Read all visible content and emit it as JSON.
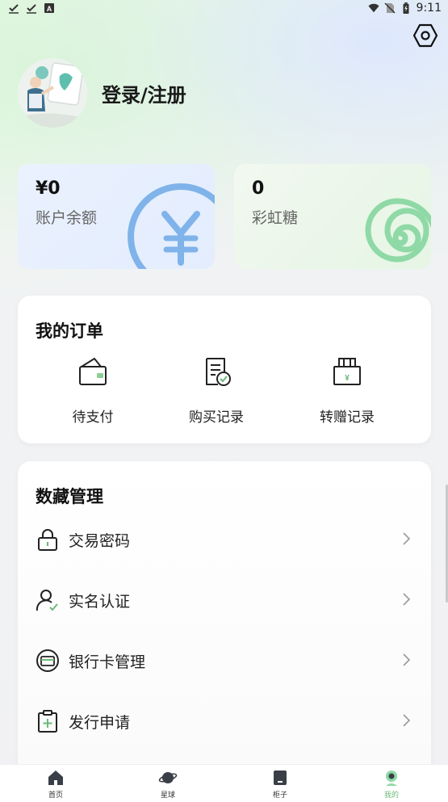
{
  "status_bar": {
    "time": "9:11",
    "left_icons": [
      "check-icon",
      "check-icon",
      "app-a-icon"
    ],
    "right_icons": [
      "wifi-icon",
      "no-sim-icon",
      "battery-icon"
    ]
  },
  "header": {
    "login_label": "登录/注册",
    "settings_icon": "hexagon-settings-icon"
  },
  "cards": {
    "balance": {
      "value": "¥0",
      "label": "账户余额",
      "accent": "#7fb3ea"
    },
    "candy": {
      "value": "0",
      "label": "彩虹糖",
      "accent": "#8fd9a6"
    }
  },
  "orders": {
    "title": "我的订单",
    "items": [
      {
        "label": "待支付",
        "icon": "wallet-icon"
      },
      {
        "label": "购买记录",
        "icon": "receipt-check-icon"
      },
      {
        "label": "转赠记录",
        "icon": "gift-box-icon"
      }
    ]
  },
  "manage": {
    "title": "数藏管理",
    "items": [
      {
        "label": "交易密码",
        "icon": "lock-icon"
      },
      {
        "label": "实名认证",
        "icon": "user-verified-icon"
      },
      {
        "label": "银行卡管理",
        "icon": "bank-card-icon"
      },
      {
        "label": "发行申请",
        "icon": "clipboard-plus-icon"
      }
    ]
  },
  "bottom_nav": {
    "items": [
      {
        "label": "首页",
        "icon": "home-icon"
      },
      {
        "label": "星球",
        "icon": "planet-icon"
      },
      {
        "label": "柜子",
        "icon": "cabinet-icon"
      },
      {
        "label": "我的",
        "icon": "profile-icon"
      }
    ],
    "active_color": "#6db97a"
  }
}
